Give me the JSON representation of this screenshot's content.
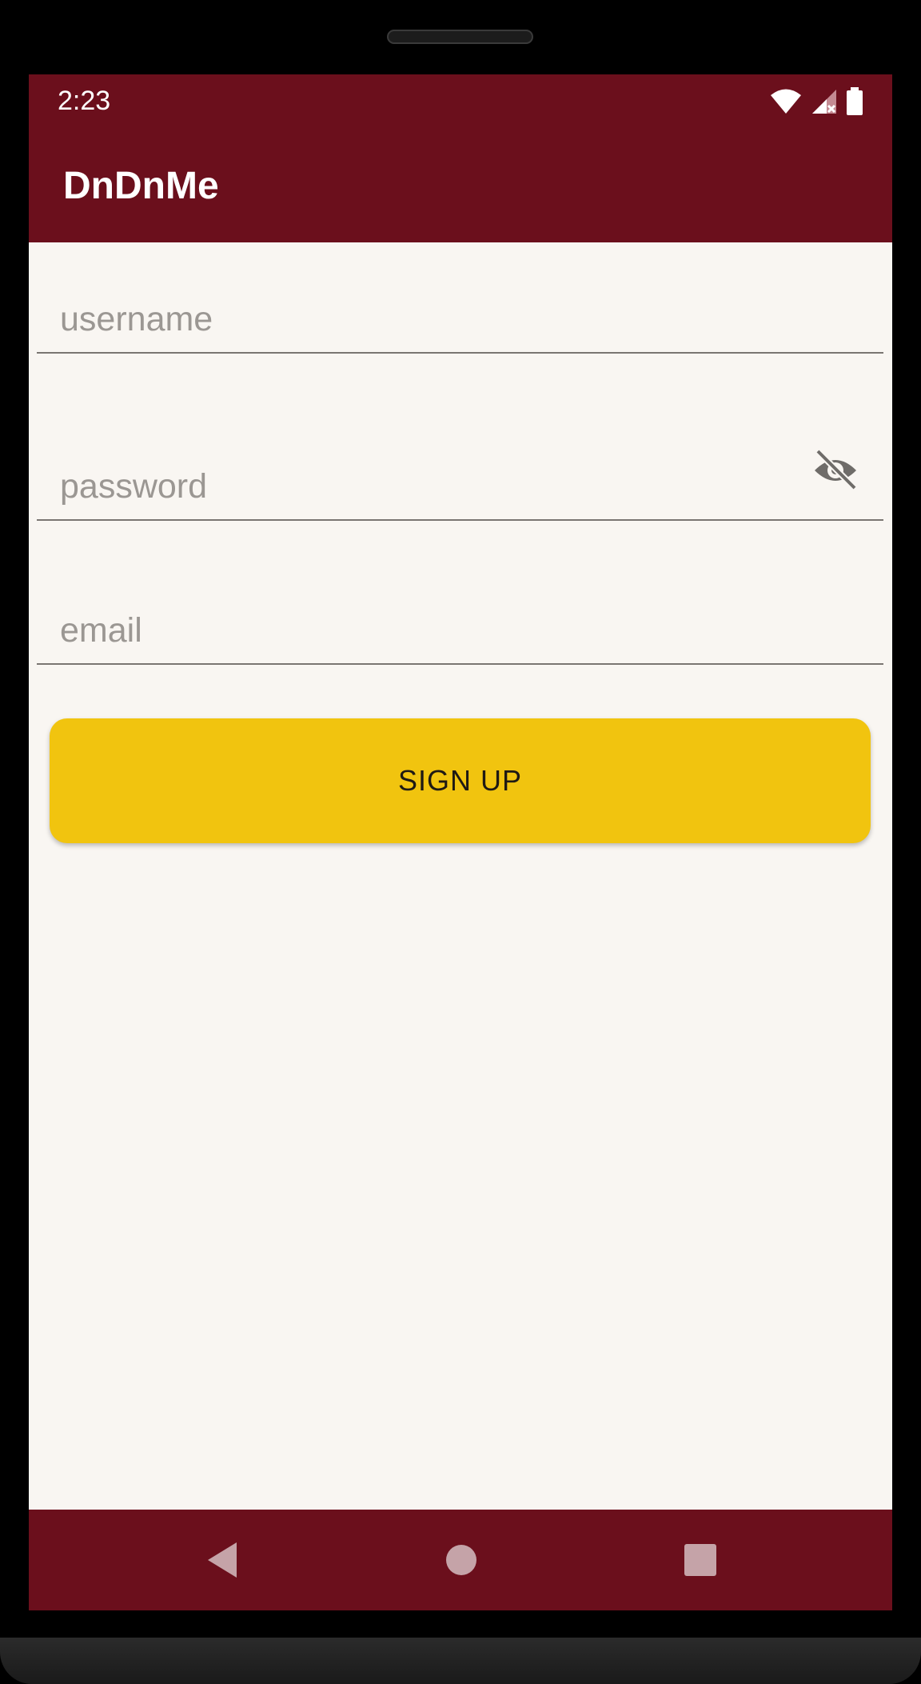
{
  "status_bar": {
    "time": "2:23",
    "icons": [
      "wifi-icon",
      "signal-icon",
      "battery-icon"
    ]
  },
  "app_bar": {
    "title": "DnDnMe"
  },
  "form": {
    "username": {
      "value": "",
      "placeholder": "username"
    },
    "password": {
      "value": "",
      "placeholder": "password",
      "toggle_icon": "visibility-off-icon"
    },
    "email": {
      "value": "",
      "placeholder": "email"
    },
    "submit_label": "SIGN UP"
  },
  "nav_bar": {
    "buttons": [
      "back-icon",
      "home-icon",
      "recents-icon"
    ]
  },
  "colors": {
    "primary": "#6b0f1c",
    "accent": "#f1c40f",
    "background": "#f9f6f2"
  }
}
